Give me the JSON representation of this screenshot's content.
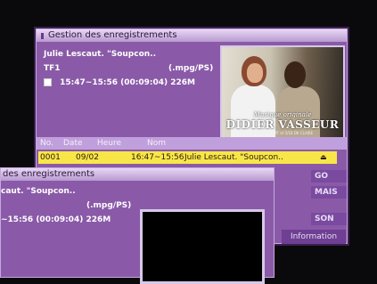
{
  "window": {
    "title": "Gestion des enregistrements"
  },
  "selected": {
    "program_title": "Julie Lescaut. \"Soupcon..",
    "channel": "TF1",
    "format": "(.mpg/PS)",
    "time_range": "15:47~15:56 (00:09:04) 226M"
  },
  "thumbnail": {
    "caption_small": "Musique originale",
    "caption_main": "DIDIER VASSEUR",
    "caption_tiny": "éditée par SMT et 5/18 DK CLAIRE"
  },
  "table": {
    "headers": [
      "No.",
      "Date",
      "Heure",
      "Nom"
    ],
    "rows": [
      {
        "no": "0001",
        "date": "09/02",
        "time": "16:47~15:56",
        "name": "Julie Lescaut. \"Soupcon..",
        "icon": "lock-icon"
      }
    ]
  },
  "side_buttons": [
    "GO",
    "MAIS",
    "SON"
  ],
  "infobar": {
    "label": "Information"
  },
  "back_window": {
    "title": "des enregistrements",
    "program_title": "caut. \"Soupcon..",
    "format": "(.mpg/PS)",
    "time_range": "~15:56 (00:09:04) 226M"
  }
}
